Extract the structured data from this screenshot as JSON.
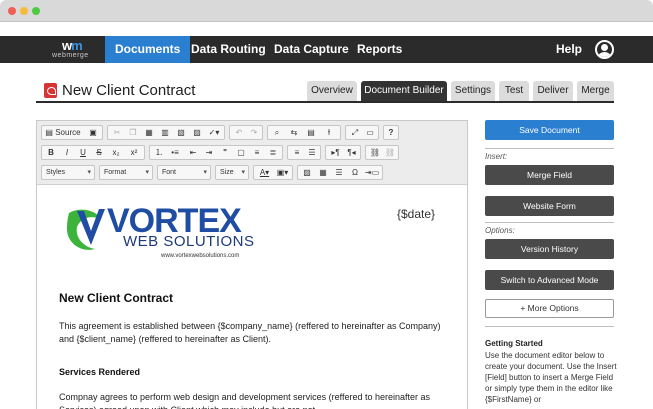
{
  "app": {
    "logo_text": "webmerge"
  },
  "nav": {
    "items": [
      {
        "label": "Documents",
        "active": true
      },
      {
        "label": "Data Routing",
        "active": false
      },
      {
        "label": "Data Capture",
        "active": false
      },
      {
        "label": "Reports",
        "active": false
      }
    ],
    "help_label": "Help"
  },
  "document": {
    "title": "New Client Contract",
    "icon": "pdf-icon"
  },
  "tabs": [
    {
      "label": "Overview",
      "active": false
    },
    {
      "label": "Document Builder",
      "active": true
    },
    {
      "label": "Settings",
      "active": false
    },
    {
      "label": "Test",
      "active": false
    },
    {
      "label": "Deliver",
      "active": false
    },
    {
      "label": "Merge",
      "active": false
    }
  ],
  "toolbar": {
    "source_label": "Source",
    "styles_label": "Styles",
    "format_label": "Format",
    "font_label": "Font",
    "size_label": "Size"
  },
  "content": {
    "logo_main": "VORTEX",
    "logo_sub": "WEB SOLUTIONS",
    "logo_url": "www.vortexwebsolutions.com",
    "date_token": "{$date}",
    "heading": "New Client Contract",
    "paragraph1": "This agreement is established between {$company_name} (reffered to hereinafter as Company) and {$client_name} (reffered to hereinafter as Client).",
    "section_heading": "Services Rendered",
    "paragraph2": "Compnay agrees to perform web design and development services (reffered to hereinafter as Services) agreed upon with Client which may include but are not"
  },
  "sidebar": {
    "save_label": "Save Document",
    "insert_label": "Insert:",
    "merge_field_label": "Merge Field",
    "website_form_label": "Website Form",
    "options_label": "Options:",
    "version_history_label": "Version History",
    "advanced_mode_label": "Switch to Advanced Mode",
    "more_options_label": "+ More Options",
    "getting_started_title": "Getting Started",
    "getting_started_text": "Use the document editor below to create your document. Use the Insert [Field] button to insert a Merge Field or simply type them in the editor like {$FirstName} or"
  },
  "colors": {
    "accent": "#2b7fd1",
    "nav_bg": "#2b2b2b",
    "dark_button": "#4a4a4a",
    "logo_blue": "#1f4da3",
    "logo_green": "#3cb43c"
  }
}
